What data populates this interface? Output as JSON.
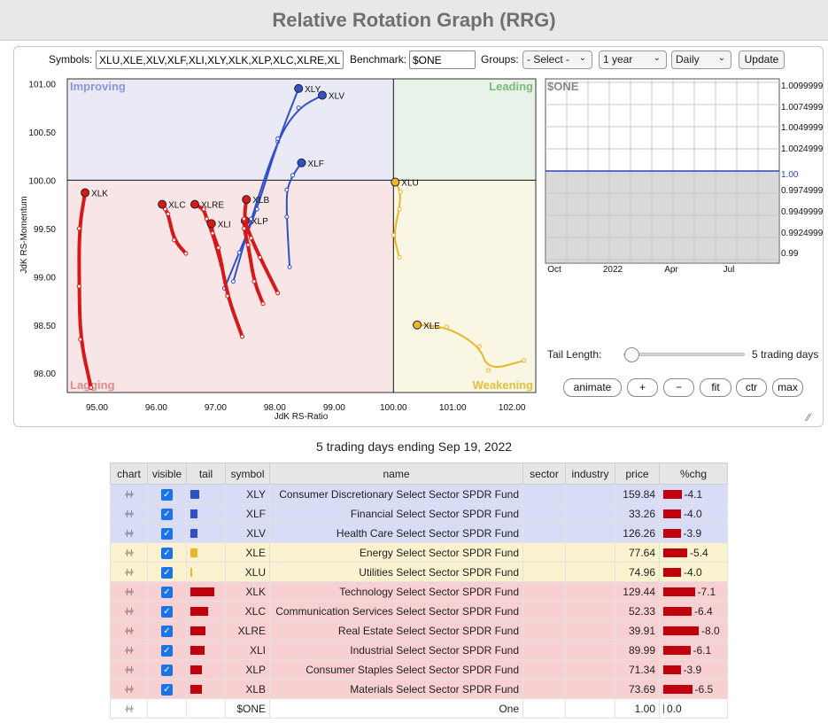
{
  "title": "Relative Rotation Graph (RRG)",
  "controls": {
    "symbols_label": "Symbols:",
    "symbols_value": "XLU,XLE,XLV,XLF,XLI,XLY,XLK,XLP,XLC,XLRE,XLB",
    "benchmark_label": "Benchmark:",
    "benchmark_value": "$ONE",
    "groups_label": "Groups:",
    "groups_value": "- Select -",
    "period_value": "1 year",
    "frequency_value": "Daily",
    "update_label": "Update"
  },
  "chart_data": [
    {
      "type": "scatter",
      "title": "",
      "xlabel": "JdK RS-Ratio",
      "ylabel": "JdK RS-Momentum",
      "xlim": [
        94.5,
        102.4
      ],
      "ylim": [
        97.8,
        101.05
      ],
      "xticks": [
        95,
        96,
        97,
        98,
        99,
        100,
        101,
        102
      ],
      "yticks": [
        98,
        98.5,
        99,
        99.5,
        100,
        100.5,
        101
      ],
      "xtick_labels": [
        "95.00",
        "96.00",
        "97.00",
        "98.00",
        "99.00",
        "100.00",
        "101.00",
        "102.00"
      ],
      "ytick_labels": [
        "98.00",
        "98.50",
        "99.00",
        "99.50",
        "100.00",
        "100.50",
        "101.00"
      ],
      "center": [
        100,
        100
      ],
      "quadrants": [
        {
          "name": "Improving",
          "color": "#eaeaf6",
          "label_color": "#8c96d8"
        },
        {
          "name": "Leading",
          "color": "#e8f2e8",
          "label_color": "#7cbb7c"
        },
        {
          "name": "Lagging",
          "color": "#f8e6e6",
          "label_color": "#e08a8a"
        },
        {
          "name": "Weakening",
          "color": "#f9f6e4",
          "label_color": "#e3c13c"
        }
      ],
      "series": [
        {
          "name": "XLY",
          "color": "#3050c8",
          "points": [
            [
              97.15,
              98.88
            ],
            [
              97.4,
              99.25
            ],
            [
              97.7,
              99.7
            ],
            [
              98.05,
              100.4
            ],
            [
              98.4,
              100.95
            ]
          ]
        },
        {
          "name": "XLV",
          "color": "#3050c8",
          "points": [
            [
              97.3,
              98.95
            ],
            [
              97.6,
              99.6
            ],
            [
              98.05,
              100.43
            ],
            [
              98.4,
              100.75
            ],
            [
              98.8,
              100.88
            ]
          ]
        },
        {
          "name": "XLF",
          "color": "#3050c8",
          "points": [
            [
              98.25,
              99.1
            ],
            [
              98.2,
              99.62
            ],
            [
              98.2,
              99.9
            ],
            [
              98.3,
              100.05
            ],
            [
              98.45,
              100.18
            ]
          ]
        },
        {
          "name": "XLU",
          "color": "#e8b828",
          "points": [
            [
              100.1,
              99.2
            ],
            [
              100.0,
              99.43
            ],
            [
              100.1,
              99.7
            ],
            [
              100.12,
              99.88
            ],
            [
              100.03,
              99.98
            ]
          ]
        },
        {
          "name": "XLE",
          "color": "#e8b828",
          "points": [
            [
              102.2,
              98.13
            ],
            [
              101.6,
              98.03
            ],
            [
              101.45,
              98.28
            ],
            [
              100.9,
              98.48
            ],
            [
              100.4,
              98.5
            ]
          ]
        },
        {
          "name": "XLK",
          "color": "#d81818",
          "points": [
            [
              94.9,
              97.85
            ],
            [
              94.72,
              98.35
            ],
            [
              94.7,
              98.9
            ],
            [
              94.7,
              99.5
            ],
            [
              94.8,
              99.87
            ]
          ]
        },
        {
          "name": "XLC",
          "color": "#d81818",
          "points": [
            [
              96.5,
              99.24
            ],
            [
              96.3,
              99.38
            ],
            [
              96.2,
              99.65
            ],
            [
              96.15,
              99.7
            ],
            [
              96.1,
              99.75
            ]
          ]
        },
        {
          "name": "XLRE",
          "color": "#d81818",
          "points": [
            [
              97.1,
              99.12
            ],
            [
              96.95,
              99.45
            ],
            [
              96.85,
              99.6
            ],
            [
              96.8,
              99.7
            ],
            [
              96.65,
              99.75
            ]
          ]
        },
        {
          "name": "XLI",
          "color": "#d81818",
          "points": [
            [
              97.45,
              98.38
            ],
            [
              97.2,
              98.8
            ],
            [
              97.05,
              99.3
            ],
            [
              96.95,
              99.45
            ],
            [
              96.93,
              99.55
            ]
          ]
        },
        {
          "name": "XLP",
          "color": "#d81818",
          "points": [
            [
              97.8,
              98.72
            ],
            [
              97.65,
              98.95
            ],
            [
              97.55,
              99.33
            ],
            [
              97.48,
              99.5
            ],
            [
              97.5,
              99.58
            ]
          ]
        },
        {
          "name": "XLB",
          "color": "#d81818",
          "points": [
            [
              98.05,
              98.83
            ],
            [
              97.75,
              99.2
            ],
            [
              97.6,
              99.4
            ],
            [
              97.48,
              99.6
            ],
            [
              97.52,
              99.8
            ]
          ]
        }
      ]
    },
    {
      "type": "line",
      "title": "$ONE",
      "x_tick_labels": [
        "Oct",
        "2022",
        "Apr",
        "Jul"
      ],
      "y_tick_labels": [
        "1.0099999",
        "1.0074999",
        "1.0049999",
        "1.0024999",
        "1.00",
        "0.9974999",
        "0.9949999",
        "0.9924999",
        "0.99"
      ],
      "ylim": [
        0.99,
        1.01
      ],
      "series": [
        {
          "values": [
            1.0,
            1.0
          ]
        }
      ]
    }
  ],
  "tail": {
    "label": "Tail Length:",
    "value_label": "5 trading days",
    "value": 5
  },
  "buttons": {
    "animate": "animate",
    "plus": "+",
    "minus": "−",
    "fit": "fit",
    "ctr": "ctr",
    "max": "max"
  },
  "caption": "5 trading days ending Sep 19, 2022",
  "table": {
    "headers": [
      "chart",
      "visible",
      "tail",
      "symbol",
      "name",
      "sector",
      "industry",
      "price",
      "%chg"
    ],
    "rows": [
      {
        "symbol": "XLY",
        "name": "Consumer Discretionary Select Sector SPDR Fund",
        "price": "159.84",
        "chg": "-4.1",
        "chg_value": -4.1,
        "tail_color": "#3050c8",
        "tail_width": 10,
        "row_color": "#d8dcf6",
        "visible": true
      },
      {
        "symbol": "XLF",
        "name": "Financial Select Sector SPDR Fund",
        "price": "33.26",
        "chg": "-4.0",
        "chg_value": -4.0,
        "tail_color": "#3050c8",
        "tail_width": 8,
        "row_color": "#d8dcf6",
        "visible": true
      },
      {
        "symbol": "XLV",
        "name": "Health Care Select Sector SPDR Fund",
        "price": "126.26",
        "chg": "-3.9",
        "chg_value": -3.9,
        "tail_color": "#3050c8",
        "tail_width": 8,
        "row_color": "#d8dcf6",
        "visible": true
      },
      {
        "symbol": "XLE",
        "name": "Energy Select Sector SPDR Fund",
        "price": "77.64",
        "chg": "-5.4",
        "chg_value": -5.4,
        "tail_color": "#e8b828",
        "tail_width": 8,
        "row_color": "#fbf3d0",
        "visible": true
      },
      {
        "symbol": "XLU",
        "name": "Utilities Select Sector SPDR Fund",
        "price": "74.96",
        "chg": "-4.0",
        "chg_value": -4.0,
        "tail_color": "#e8b828",
        "tail_width": 2,
        "row_color": "#fbf3d0",
        "visible": true
      },
      {
        "symbol": "XLK",
        "name": "Technology Select Sector SPDR Fund",
        "price": "129.44",
        "chg": "-7.1",
        "chg_value": -7.1,
        "tail_color": "#c0000c",
        "tail_width": 27,
        "row_color": "#f8d0d2",
        "visible": true
      },
      {
        "symbol": "XLC",
        "name": "Communication Services Select Sector SPDR Fund",
        "price": "52.33",
        "chg": "-6.4",
        "chg_value": -6.4,
        "tail_color": "#c0000c",
        "tail_width": 20,
        "row_color": "#f8d0d2",
        "visible": true
      },
      {
        "symbol": "XLRE",
        "name": "Real Estate Select Sector SPDR Fund",
        "price": "39.91",
        "chg": "-8.0",
        "chg_value": -8.0,
        "tail_color": "#c0000c",
        "tail_width": 17,
        "row_color": "#f8d0d2",
        "visible": true
      },
      {
        "symbol": "XLI",
        "name": "Industrial Select Sector SPDR Fund",
        "price": "89.99",
        "chg": "-6.1",
        "chg_value": -6.1,
        "tail_color": "#c0000c",
        "tail_width": 16,
        "row_color": "#f8d0d2",
        "visible": true
      },
      {
        "symbol": "XLP",
        "name": "Consumer Staples Select Sector SPDR Fund",
        "price": "71.34",
        "chg": "-3.9",
        "chg_value": -3.9,
        "tail_color": "#c0000c",
        "tail_width": 13,
        "row_color": "#f8d0d2",
        "visible": true
      },
      {
        "symbol": "XLB",
        "name": "Materials Select Sector SPDR Fund",
        "price": "73.69",
        "chg": "-6.5",
        "chg_value": -6.5,
        "tail_color": "#c0000c",
        "tail_width": 13,
        "row_color": "#f8d0d2",
        "visible": true
      },
      {
        "symbol": "$ONE",
        "name": "One",
        "price": "1.00",
        "chg": "0.0",
        "chg_value": 0.0,
        "tail_color": "",
        "tail_width": 0,
        "row_color": "#ffffff",
        "visible": false
      }
    ]
  }
}
